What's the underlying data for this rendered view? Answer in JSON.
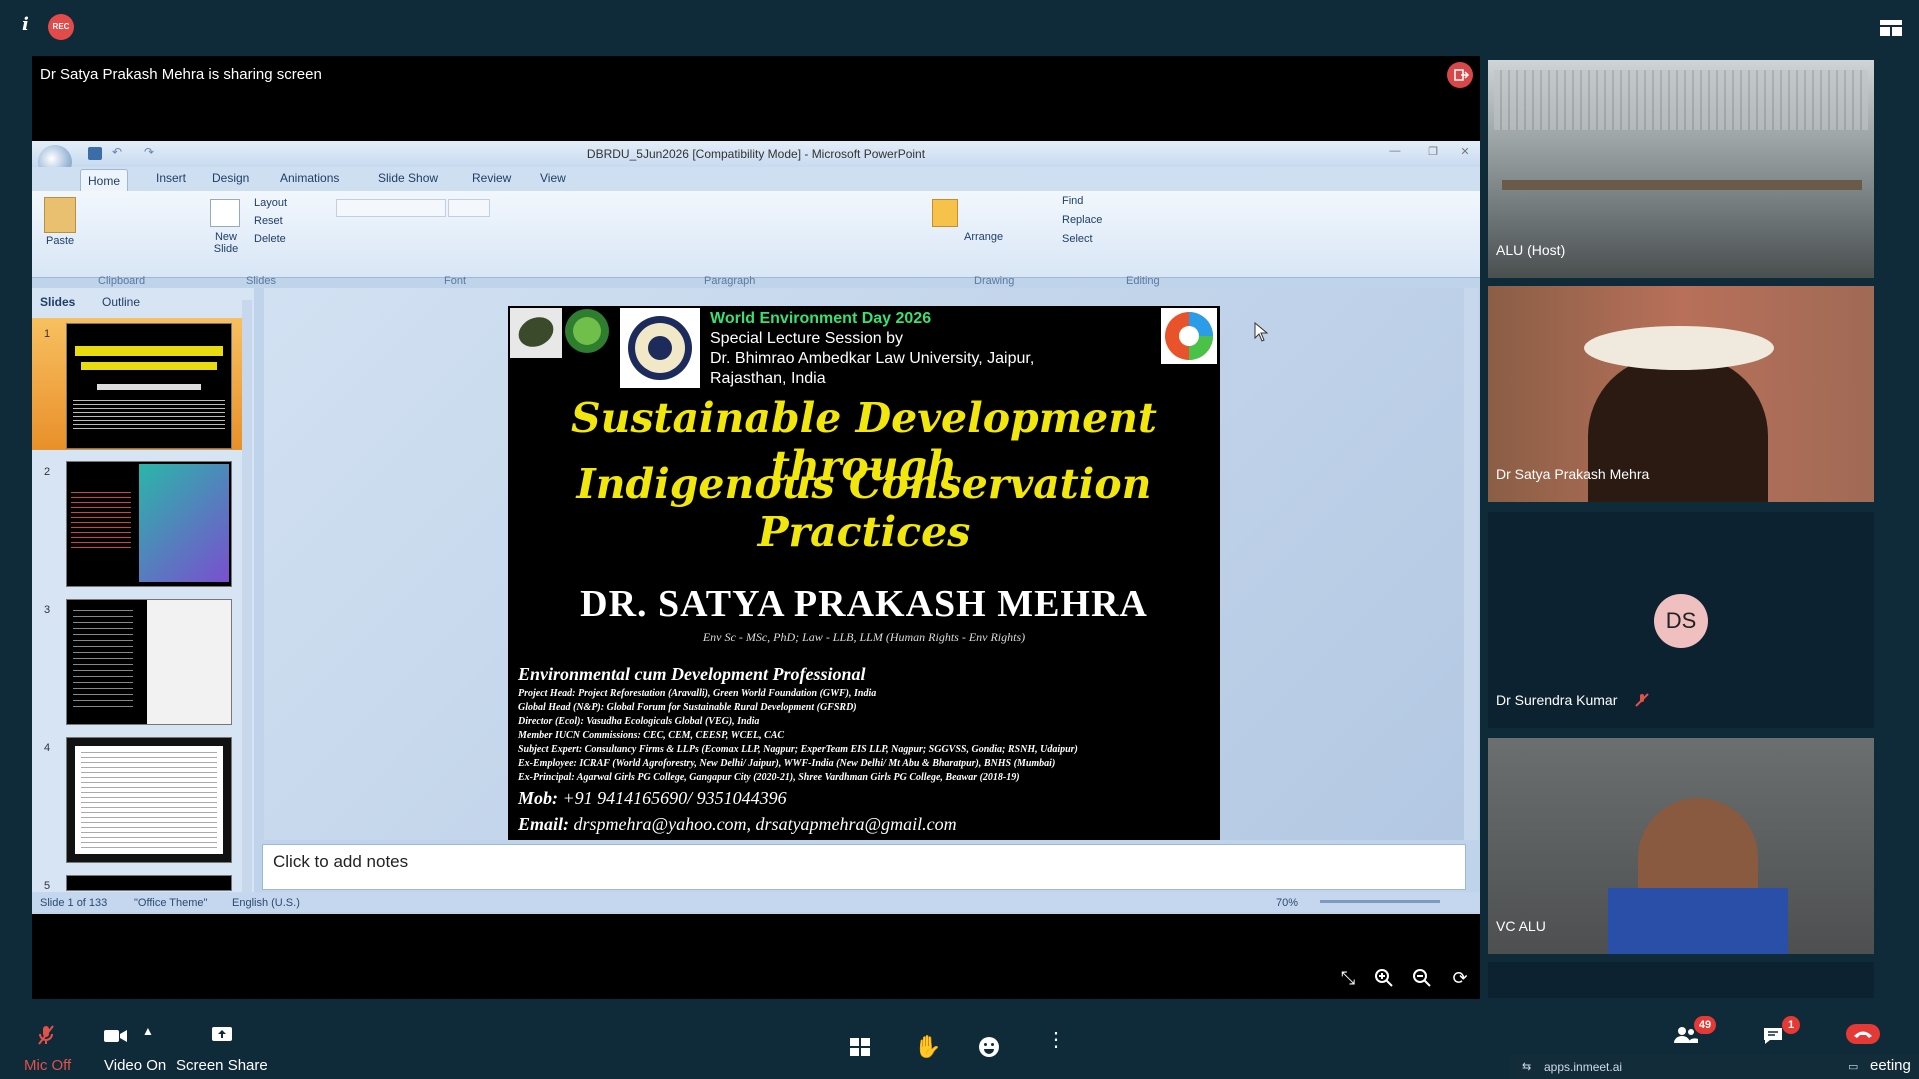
{
  "top": {
    "info_glyph": "i",
    "rec_label": "REC"
  },
  "share": {
    "title": "Dr Satya Prakash Mehra is sharing screen"
  },
  "ppt": {
    "window_title": "DBRDU_5Jun2026 [Compatibility Mode] - Microsoft PowerPoint",
    "tabs": [
      "Home",
      "Insert",
      "Design",
      "Animations",
      "Slide Show",
      "Review",
      "View"
    ],
    "groups": {
      "clipboard": "Clipboard",
      "slides": "Slides",
      "font": "Font",
      "paragraph": "Paragraph",
      "drawing": "Drawing",
      "editing": "Editing"
    },
    "buttons": {
      "paste": "Paste",
      "new_slide": "New Slide",
      "layout": "Layout",
      "reset": "Reset",
      "delete": "Delete",
      "arrange": "Arrange",
      "find": "Find",
      "replace": "Replace",
      "select": "Select"
    },
    "pane_tabs": {
      "slides": "Slides",
      "outline": "Outline"
    },
    "thumb_numbers": [
      "1",
      "2",
      "3",
      "4",
      "5"
    ],
    "notes_placeholder": "Click to add notes",
    "status": {
      "slide_count": "Slide 1 of 133",
      "theme": "\"Office Theme\"",
      "language": "English (U.S.)",
      "zoom": "70%"
    }
  },
  "slide": {
    "event": "World Environment Day 2026",
    "session": "Special Lecture Session by",
    "university_line1": "Dr. Bhimrao Ambedkar Law University, Jaipur,",
    "university_line2": "Rajasthan, India",
    "title_line1": "Sustainable Development through",
    "title_line2": "Indigenous Conservation Practices",
    "speaker": "DR. SATYA PRAKASH MEHRA",
    "qualifications": "Env Sc - MSc, PhD; Law - LLB, LLM (Human Rights - Env Rights)",
    "role": "Environmental cum Development Professional",
    "details": [
      "Project Head: Project Reforestation (Aravalli), Green World Foundation (GWF), India",
      "Global Head (N&P): Global Forum for Sustainable Rural Development (GFSRD)",
      "Director (Ecol): Vasudha Ecologicals Global (VEG), India",
      "Member IUCN Commissions: CEC, CEM, CEESP, WCEL, CAC",
      "Subject Expert: Consultancy Firms & LLPs (Ecomax LLP, Nagpur; ExperTeam EIS LLP, Nagpur; SGGVSS, Gondia; RSNH, Udaipur)",
      "Ex-Employee: ICRAF (World Agroforestry, New Delhi/ Jaipur), WWF-India (New Delhi/ Mt Abu & Bharatpur), BNHS (Mumbai)",
      "Ex-Principal: Agarwal Girls PG College, Gangapur City (2020-21), Shree Vardhman Girls PG College, Beawar (2018-19)"
    ],
    "mob_label": "Mob:",
    "mob_value": "+91 9414165690/ 9351044396",
    "email_label": "Email:",
    "email_value": "drspmehra@yahoo.com, drsatyapmehra@gmail.com"
  },
  "participants": [
    {
      "name": "ALU (Host)"
    },
    {
      "name": "Dr Satya Prakash Mehra"
    },
    {
      "name": "Dr Surendra Kumar",
      "initials": "DS"
    },
    {
      "name": "VC ALU"
    }
  ],
  "toolbar": {
    "mic": "Mic Off",
    "video": "Video On",
    "screen_share": "Screen Share",
    "participants_count": "49",
    "chat_count": "1",
    "meeting_label": "eeting",
    "apps_url": "apps.inmeet.ai"
  },
  "colors": {
    "slide_yellow": "#f2e70c",
    "slide_green": "#39e070",
    "end_call": "#e53935",
    "mic_off": "#e0524a"
  }
}
